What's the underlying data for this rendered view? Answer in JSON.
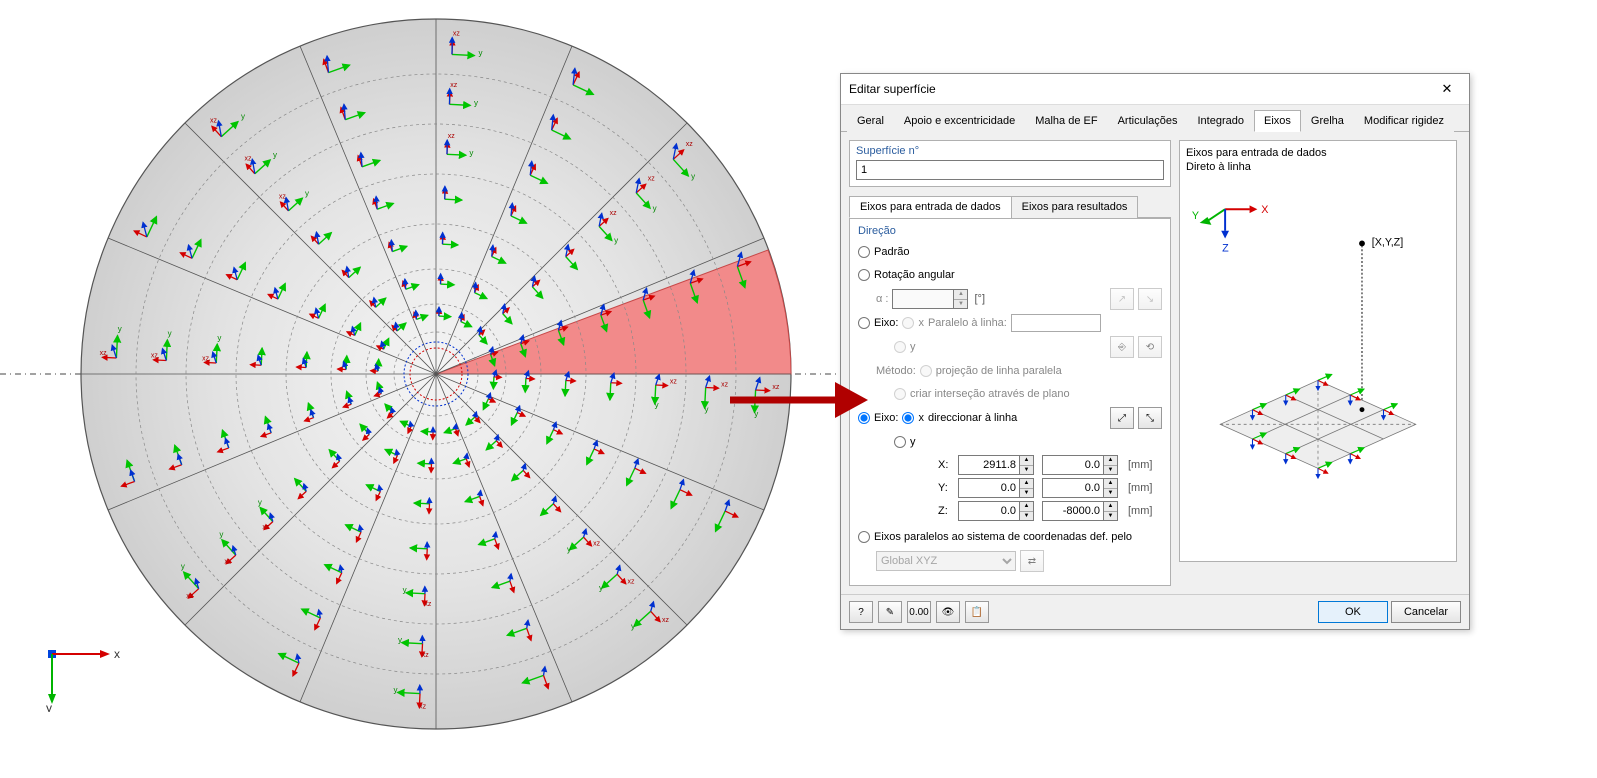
{
  "dialog": {
    "title": "Editar superfície",
    "tabs": [
      "Geral",
      "Apoio e excentricidade",
      "Malha de EF",
      "Articulações",
      "Integrado",
      "Eixos",
      "Grelha",
      "Modificar rigidez"
    ],
    "active_tab": "Eixos",
    "surface_no_label": "Superfície n°",
    "surface_no_value": "1",
    "subtabs": {
      "input": "Eixos para entrada de dados",
      "results": "Eixos para resultados"
    },
    "direction": {
      "legend": "Direção",
      "standard": "Padrão",
      "angular_rotation": "Rotação angular",
      "alpha": "α :",
      "alpha_unit": "[°]",
      "axis_label": "Eixo:",
      "x_lbl": "x",
      "y_lbl": "y",
      "parallel_to_line": "Paralelo à linha:",
      "method_label": "Método:",
      "method_proj": "projeção de linha paralela",
      "method_inter": "criar interseção através de plano",
      "direct_to_line": "direccionar à linha",
      "X_lbl": "X:",
      "Y_lbl": "Y:",
      "Z_lbl": "Z:",
      "coord_X1": "2911.8",
      "coord_X2": "0.0",
      "coord_Y1": "0.0",
      "coord_Y2": "0.0",
      "coord_Z1": "0.0",
      "coord_Z2": "-8000.0",
      "unit_mm": "[mm]",
      "parallel_ucs": "Eixos paralelos ao sistema de coordenadas def. pelo",
      "ucs_value": "Global XYZ"
    },
    "preview": {
      "line1": "Eixos para entrada de dados",
      "line2": "Direto à linha",
      "xyz": "[X,Y,Z]"
    },
    "footer": {
      "ok": "OK",
      "cancel": "Cancelar"
    }
  },
  "viewport": {
    "axis_x": "x",
    "axis_y": "y"
  },
  "chart_data": {
    "type": "diagram",
    "description": "Circular FEM slab surface showing local axis orientation (green y, red/blue xz) rotated to radial direction; one highlighted red wedge sector between approx 0° and 20°.",
    "radius_approx_mm": 2911.8,
    "highlight_sector_deg": [
      0,
      20
    ],
    "axes_dialog_selection": "Eixo x direccionar à linha",
    "point_from": [
      2911.8,
      0.0,
      0.0
    ],
    "point_to": [
      0.0,
      0.0,
      -8000.0
    ]
  }
}
